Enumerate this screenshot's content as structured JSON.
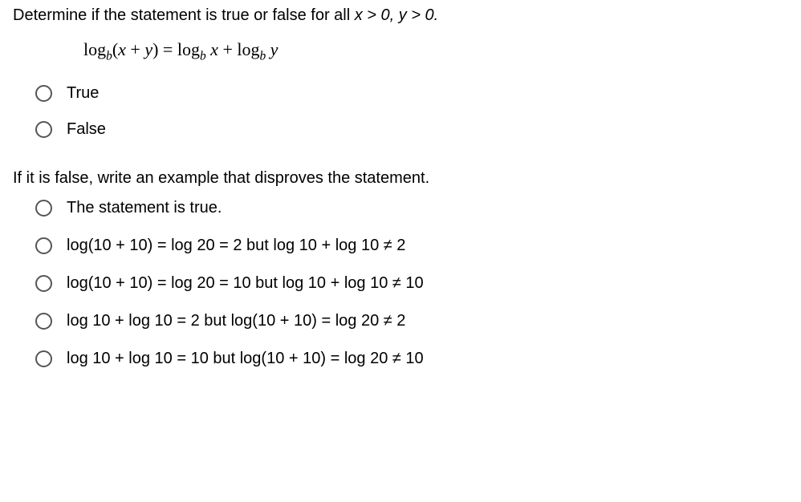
{
  "question1": {
    "prompt_prefix": "Determine if the statement is true or false for all  ",
    "prompt_math": "x > 0, y > 0.",
    "equation_html": "log<sub>b</sub>(<span class='italic'>x</span> + <span class='italic'>y</span>) = log<sub>b</sub> <span class='italic'>x</span> + log<sub>b</sub> <span class='italic'>y</span>",
    "options": [
      "True",
      "False"
    ]
  },
  "question2": {
    "prompt": "If it is false, write an example that disproves the statement.",
    "options": [
      "The statement is true.",
      "log(10 + 10) = log 20 = 2 but log 10 + log 10 ≠ 2",
      "log(10 + 10) = log 20 = 10 but log 10 + log 10 ≠ 10",
      "log 10 + log 10 = 2 but log(10 + 10) = log 20 ≠ 2",
      "log 10 + log 10 = 10 but log(10 + 10) = log 20 ≠ 10"
    ]
  }
}
